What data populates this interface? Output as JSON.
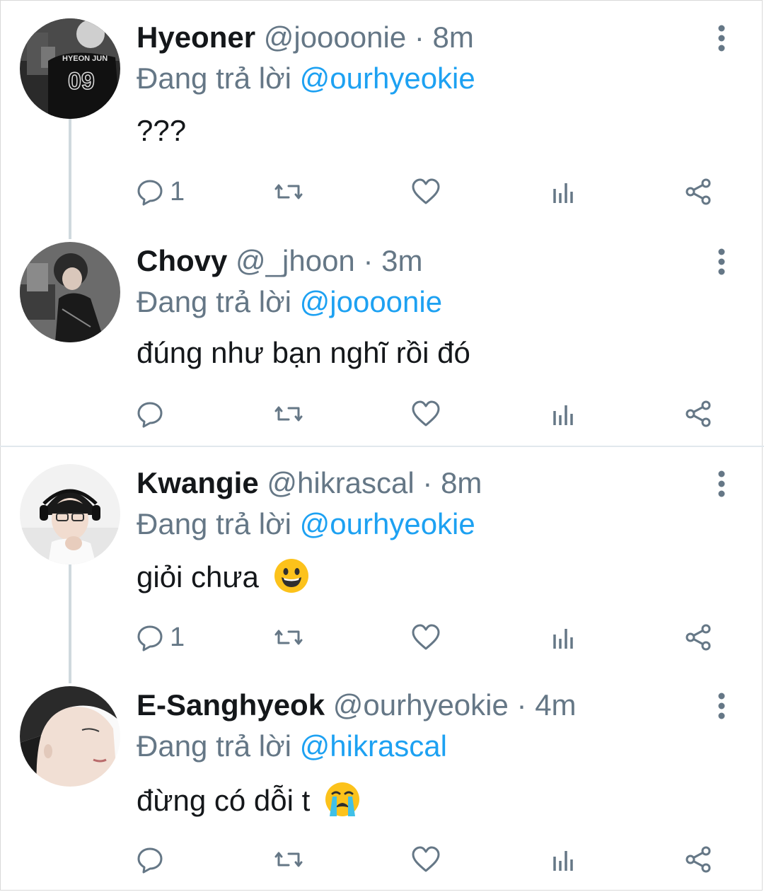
{
  "tweets": [
    {
      "display_name": "Hyeoner",
      "handle": "@joooonie",
      "separator": "·",
      "time": "8m",
      "reply_prefix": "Đang trả lời",
      "reply_to": "@ourhyeokie",
      "text": "???",
      "reply_count": "1",
      "avatar_text_top": "HYEON JUN",
      "avatar_text_number": "09"
    },
    {
      "display_name": "Chovy",
      "handle": "@_jhoon",
      "separator": "·",
      "time": "3m",
      "reply_prefix": "Đang trả lời",
      "reply_to": "@joooonie",
      "text": "đúng như bạn nghĩ rồi đó",
      "reply_count": ""
    },
    {
      "display_name": "Kwangie",
      "handle": "@hikrascal",
      "separator": "·",
      "time": "8m",
      "reply_prefix": "Đang trả lời",
      "reply_to": "@ourhyeokie",
      "text": "giỏi chưa",
      "emoji": "grinning-face",
      "reply_count": "1"
    },
    {
      "display_name": "E-Sanghyeok",
      "handle": "@ourhyeokie",
      "separator": "·",
      "time": "4m",
      "reply_prefix": "Đang trả lời",
      "reply_to": "@hikrascal",
      "text": "đừng có dỗi t",
      "emoji": "loudly-crying-face",
      "reply_count": ""
    }
  ],
  "colors": {
    "text": "#14171a",
    "secondary": "#657786",
    "link": "#1da1f2",
    "thread_line": "#cfd9de",
    "divider": "#e1e8ed"
  },
  "icons": [
    "reply-icon",
    "retweet-icon",
    "like-icon",
    "analytics-icon",
    "share-icon",
    "more-icon"
  ]
}
